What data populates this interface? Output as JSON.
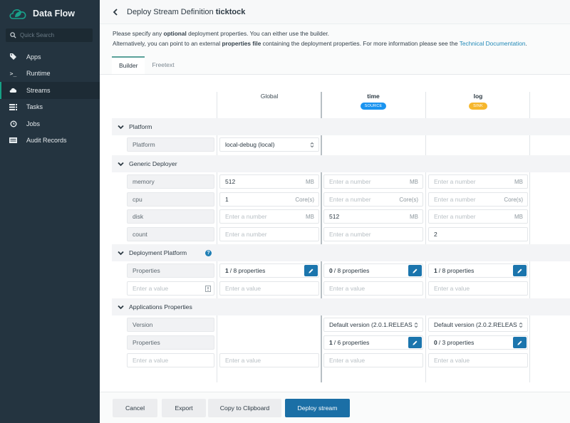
{
  "sidebar": {
    "brand": "Data Flow",
    "search_placeholder": "Quick Search",
    "items": [
      {
        "label": "Apps",
        "icon": "tags-icon"
      },
      {
        "label": "Runtime",
        "icon": "terminal-icon"
      },
      {
        "label": "Streams",
        "icon": "cloud-icon",
        "active": true
      },
      {
        "label": "Tasks",
        "icon": "tasks-icon"
      },
      {
        "label": "Jobs",
        "icon": "clock-icon"
      },
      {
        "label": "Audit Records",
        "icon": "audit-icon"
      }
    ]
  },
  "header": {
    "title_prefix": "Deploy Stream Definition",
    "stream_name": "ticktock"
  },
  "intro": {
    "line1_a": "Please specify any",
    "line1_bold": "optional",
    "line1_b": "deployment properties. You can either use the builder.",
    "line2_a": "Alternatively, you can point to an external",
    "line2_bold": "properties file",
    "line2_b": "containing the deployment properties. For more information please see the",
    "link": "Technical Documentation",
    "line2_end": "."
  },
  "tabs": [
    {
      "label": "Builder",
      "active": true
    },
    {
      "label": "Freetext",
      "active": false
    }
  ],
  "columns": {
    "global": {
      "name": "Global"
    },
    "time": {
      "name": "time",
      "badge": "SOURCE",
      "badge_color": "#1a94f0"
    },
    "log": {
      "name": "log",
      "badge": "SINK",
      "badge_color": "#f6b72d"
    }
  },
  "sections": {
    "platform": {
      "title": "Platform",
      "key": "Platform",
      "global_value": "local-debug (local)"
    },
    "generic": {
      "title": "Generic Deployer",
      "rows": [
        {
          "key": "memory",
          "unit": "MB",
          "global": "512",
          "time": "",
          "log": ""
        },
        {
          "key": "cpu",
          "unit": "Core(s)",
          "global": "1",
          "time": "",
          "log": ""
        },
        {
          "key": "disk",
          "unit": "MB",
          "global": "",
          "time": "512",
          "log": ""
        },
        {
          "key": "count",
          "unit": "",
          "global": "",
          "time": "",
          "log": "2"
        }
      ],
      "number_placeholder": "Enter a number"
    },
    "deployment": {
      "title": "Deployment Platform",
      "key": "Properties",
      "global": {
        "count": "1",
        "total": "/ 8 properties"
      },
      "time": {
        "count": "0",
        "total": "/ 8 properties"
      },
      "log": {
        "count": "1",
        "total": "/ 8 properties"
      },
      "value_placeholder": "Enter a value"
    },
    "apps": {
      "title": "Applications Properties",
      "version_key": "Version",
      "properties_key": "Properties",
      "time_version": "Default version (2.0.1.RELEAS",
      "log_version": "Default version (2.0.2.RELEAS",
      "time_props": {
        "count": "1",
        "total": "/ 6 properties"
      },
      "log_props": {
        "count": "0",
        "total": "/ 3 properties"
      },
      "value_placeholder": "Enter a value"
    }
  },
  "footer": {
    "cancel": "Cancel",
    "export": "Export",
    "copy": "Copy to Clipboard",
    "deploy": "Deploy stream"
  },
  "colors": {
    "sidebar_bg": "#243440",
    "accent": "#16a085",
    "primary": "#1b6fa6",
    "link": "#2189b7"
  }
}
